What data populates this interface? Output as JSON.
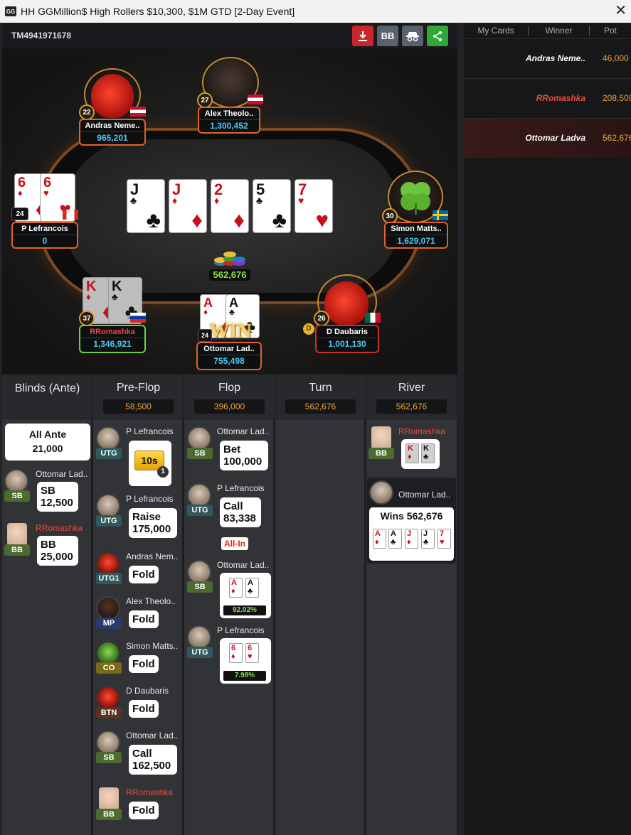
{
  "title": "HH  GGMillion$ High Rollers $10,300, $1M GTD [2-Day Event]",
  "logo_text": "GG",
  "table_id": "TM4941971678",
  "toolbar": {
    "bb_label": "BB"
  },
  "right_panel": {
    "headers": [
      "My Cards",
      "Winner",
      "Pot"
    ],
    "rows": [
      {
        "winner": "Andras Neme..",
        "pot": "46,000"
      },
      {
        "winner": "RRomashka",
        "pot": "208,500"
      },
      {
        "winner": "Ottomar Ladva",
        "pot": "562,676"
      }
    ]
  },
  "board": [
    {
      "rank": "J",
      "suit": "♣",
      "color": "black"
    },
    {
      "rank": "J",
      "suit": "♦",
      "color": "red"
    },
    {
      "rank": "2",
      "suit": "♦",
      "color": "red"
    },
    {
      "rank": "5",
      "suit": "♣",
      "color": "black"
    },
    {
      "rank": "7",
      "suit": "♥",
      "color": "red"
    }
  ],
  "pot": "562,676",
  "players": {
    "andras": {
      "name": "Andras Neme..",
      "stack": "965,201",
      "level": "22"
    },
    "alex": {
      "name": "Alex Theolo..",
      "stack": "1,300,452",
      "level": "27"
    },
    "lefrancois": {
      "name": "P Lefrancois",
      "stack": "0",
      "level": "24",
      "cards": [
        {
          "rank": "6",
          "suit": "♦"
        },
        {
          "rank": "6",
          "suit": "♥"
        }
      ]
    },
    "simon": {
      "name": "Simon Matts..",
      "stack": "1,629,071",
      "level": "30"
    },
    "rromashka": {
      "name": "RRomashka",
      "stack": "1,346,921",
      "level": "37",
      "cards": [
        {
          "rank": "K",
          "suit": "♦"
        },
        {
          "rank": "K",
          "suit": "♣"
        }
      ]
    },
    "ottomar": {
      "name": "Ottomar Lad..",
      "stack": "755,498",
      "level": "24",
      "cards": [
        {
          "rank": "A",
          "suit": "♦"
        },
        {
          "rank": "A",
          "suit": "♣"
        }
      ],
      "badge": "WIN"
    },
    "daubaris": {
      "name": "D Daubaris",
      "stack": "1,001,130",
      "level": "26",
      "dealer": "D"
    }
  },
  "streets": {
    "blinds": {
      "title": "Blinds (Ante)",
      "ante_label": "All Ante",
      "ante_value": "21,000"
    },
    "preflop": {
      "title": "Pre-Flop",
      "pot": "58,500"
    },
    "flop": {
      "title": "Flop",
      "pot": "396,000"
    },
    "turn": {
      "title": "Turn",
      "pot": "562,676"
    },
    "river": {
      "title": "River",
      "pot": "562,676"
    }
  },
  "actions": {
    "blinds": [
      {
        "name": "Ottomar Lad..",
        "pos": "SB",
        "action": "SB",
        "amount": "12,500"
      },
      {
        "name": "RRomashka",
        "pos": "BB",
        "action": "BB",
        "amount": "25,000"
      }
    ],
    "preflop": [
      {
        "name": "P Lefrancois",
        "pos": "UTG",
        "timer": "10s",
        "timer_count": "1"
      },
      {
        "name": "P Lefrancois",
        "pos": "UTG",
        "action": "Raise",
        "amount": "175,000"
      },
      {
        "name": "Andras Nem..",
        "pos": "UTG1",
        "action": "Fold"
      },
      {
        "name": "Alex Theolo..",
        "pos": "MP",
        "action": "Fold"
      },
      {
        "name": "Simon Matts..",
        "pos": "CO",
        "action": "Fold"
      },
      {
        "name": "D Daubaris",
        "pos": "BTN",
        "action": "Fold"
      },
      {
        "name": "Ottomar Lad..",
        "pos": "SB",
        "action": "Call",
        "amount": "162,500"
      },
      {
        "name": "RRomashka",
        "pos": "BB",
        "action": "Fold"
      }
    ],
    "flop": [
      {
        "name": "Ottomar Lad..",
        "pos": "SB",
        "action": "Bet",
        "amount": "100,000"
      },
      {
        "name": "P Lefrancois",
        "pos": "UTG",
        "action": "Call",
        "amount": "83,338",
        "tag": "All-In"
      },
      {
        "name": "Ottomar Lad..",
        "pos": "SB",
        "equity": "92.02%"
      },
      {
        "name": "P Lefrancois",
        "pos": "UTG",
        "equity": "7.98%"
      }
    ],
    "river": [
      {
        "name": "RRomashka",
        "pos": "BB"
      },
      {
        "name": "Ottomar Lad..",
        "result": "Wins 562,676"
      }
    ]
  },
  "river_hand": [
    {
      "rank": "A",
      "suit": "♦",
      "color": "red"
    },
    {
      "rank": "A",
      "suit": "♣",
      "color": "black"
    },
    {
      "rank": "J",
      "suit": "♦",
      "color": "red"
    },
    {
      "rank": "J",
      "suit": "♣",
      "color": "black"
    },
    {
      "rank": "7",
      "suit": "♥",
      "color": "red"
    }
  ],
  "colors": {
    "accent_orange": "#e0612b",
    "stack_blue": "#4fc7f1",
    "pot_gold": "#f0a537",
    "win_green": "#8ce04b"
  }
}
